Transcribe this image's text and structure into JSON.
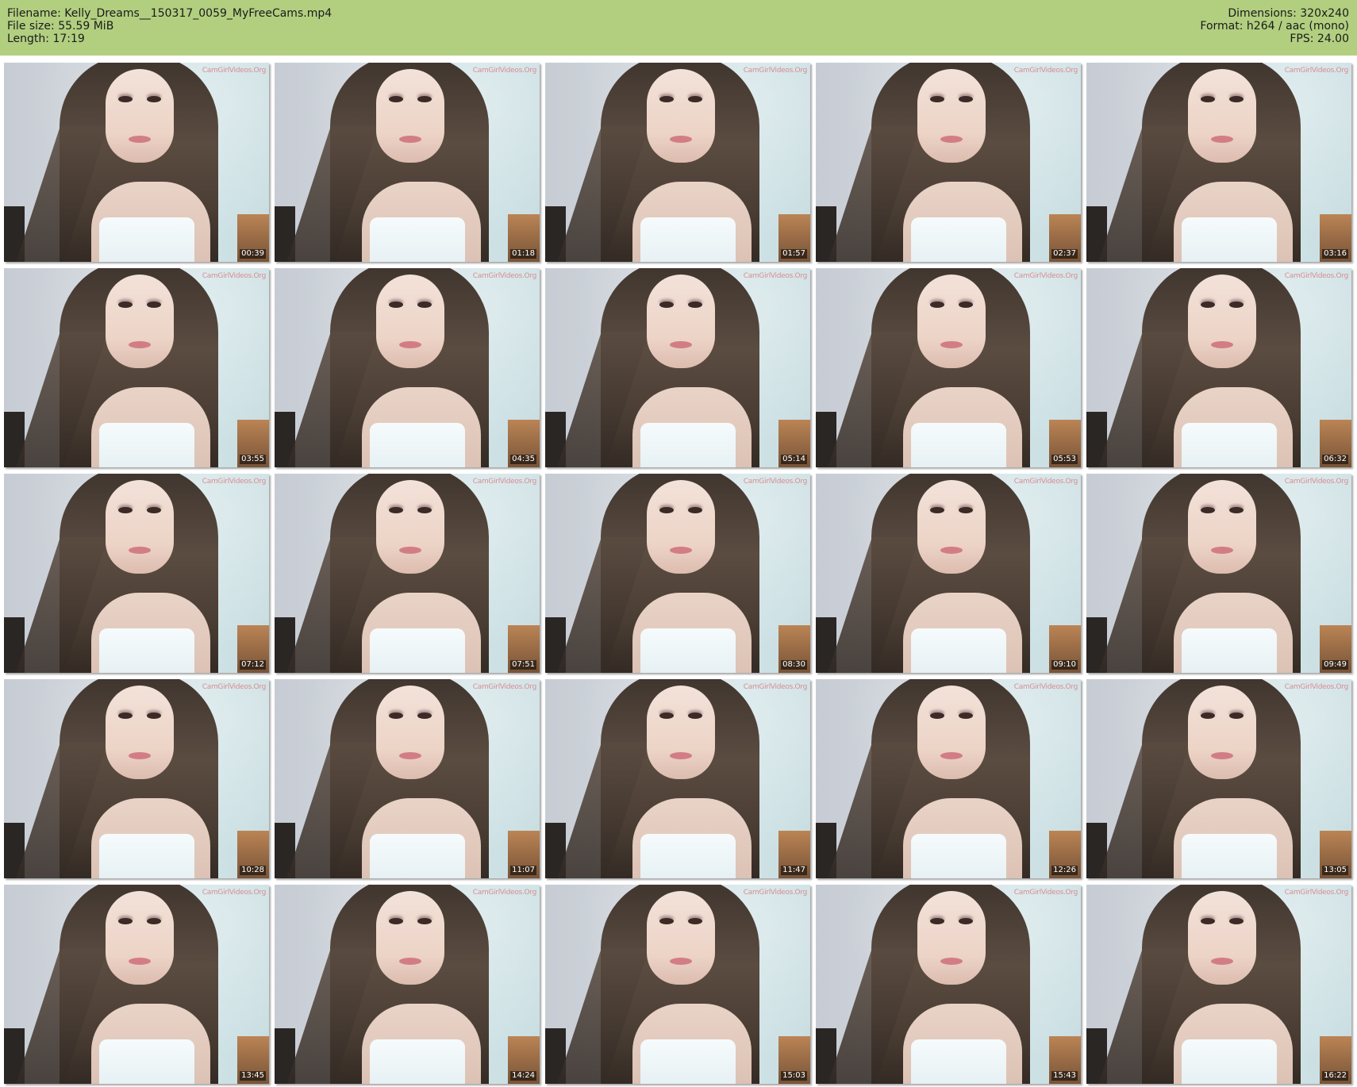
{
  "header": {
    "filename_line": "Filename: Kelly_Dreams__150317_0059_MyFreeCams.mp4",
    "filesize_line": "File size: 55.59 MiB",
    "length_line": "Length: 17:19",
    "dimensions_line": "Dimensions: 320x240",
    "format_line": "Format: h264 / aac (mono)",
    "fps_line": "FPS: 24.00",
    "background_color": "#b2cf80"
  },
  "thumbnails": [
    {
      "time": "00:39",
      "watermark": "CamGirlVideos.Org"
    },
    {
      "time": "01:18",
      "watermark": "CamGirlVideos.Org"
    },
    {
      "time": "01:57",
      "watermark": "CamGirlVideos.Org"
    },
    {
      "time": "02:37",
      "watermark": "CamGirlVideos.Org"
    },
    {
      "time": "03:16",
      "watermark": "CamGirlVideos.Org"
    },
    {
      "time": "03:55",
      "watermark": "CamGirlVideos.Org"
    },
    {
      "time": "04:35",
      "watermark": "CamGirlVideos.Org"
    },
    {
      "time": "05:14",
      "watermark": "CamGirlVideos.Org"
    },
    {
      "time": "05:53",
      "watermark": "CamGirlVideos.Org"
    },
    {
      "time": "06:32",
      "watermark": "CamGirlVideos.Org"
    },
    {
      "time": "07:12",
      "watermark": "CamGirlVideos.Org"
    },
    {
      "time": "07:51",
      "watermark": "CamGirlVideos.Org"
    },
    {
      "time": "08:30",
      "watermark": "CamGirlVideos.Org"
    },
    {
      "time": "09:10",
      "watermark": "CamGirlVideos.Org"
    },
    {
      "time": "09:49",
      "watermark": "CamGirlVideos.Org"
    },
    {
      "time": "10:28",
      "watermark": "CamGirlVideos.Org"
    },
    {
      "time": "11:07",
      "watermark": "CamGirlVideos.Org"
    },
    {
      "time": "11:47",
      "watermark": "CamGirlVideos.Org"
    },
    {
      "time": "12:26",
      "watermark": "CamGirlVideos.Org"
    },
    {
      "time": "13:05",
      "watermark": "CamGirlVideos.Org"
    },
    {
      "time": "13:45",
      "watermark": "CamGirlVideos.Org"
    },
    {
      "time": "14:24",
      "watermark": "CamGirlVideos.Org"
    },
    {
      "time": "15:03",
      "watermark": "CamGirlVideos.Org"
    },
    {
      "time": "15:43",
      "watermark": "CamGirlVideos.Org"
    },
    {
      "time": "16:22",
      "watermark": "CamGirlVideos.Org"
    }
  ]
}
